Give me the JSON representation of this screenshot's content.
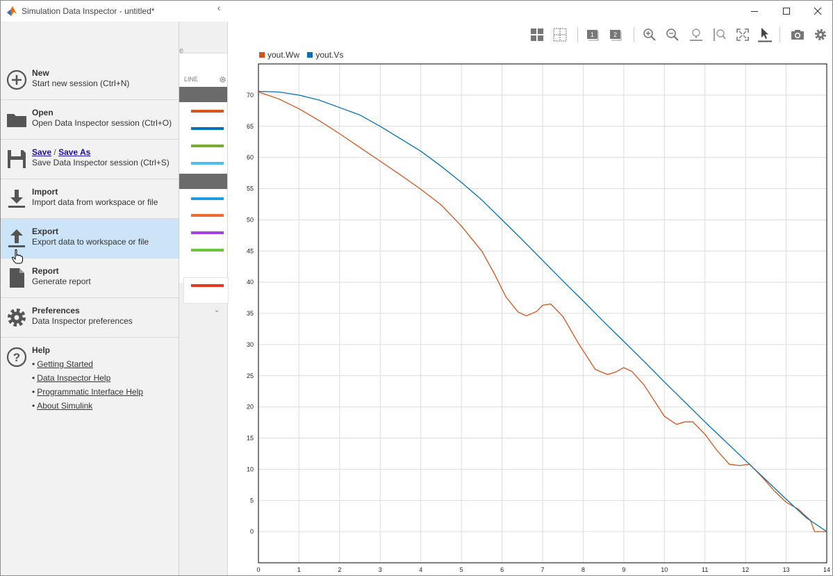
{
  "window": {
    "title": "Simulation Data Inspector - untitled*",
    "controls": [
      "minimize",
      "maximize",
      "close"
    ]
  },
  "menu": {
    "items": [
      {
        "key": "new",
        "title": "New",
        "subtitle": "Start new session (Ctrl+N)",
        "icon": "plus-circle-icon"
      },
      {
        "key": "open",
        "title": "Open",
        "subtitle": "Open Data Inspector session (Ctrl+O)",
        "icon": "folder-icon"
      },
      {
        "key": "save",
        "title": "Save",
        "title2": "Save As",
        "separator": "/",
        "subtitle": "Save Data Inspector session (Ctrl+S)",
        "icon": "floppy-disk-icon"
      },
      {
        "key": "import",
        "title": "Import",
        "subtitle": "Import data from workspace or file",
        "icon": "download-arrow-icon"
      },
      {
        "key": "export",
        "title": "Export",
        "subtitle": "Export data to workspace or file",
        "icon": "upload-arrow-icon",
        "active": true
      },
      {
        "key": "report",
        "title": "Report",
        "subtitle": "Generate report",
        "icon": "document-icon"
      },
      {
        "key": "preferences",
        "title": "Preferences",
        "subtitle": "Data Inspector preferences",
        "icon": "gear-icon"
      }
    ],
    "help": {
      "title": "Help",
      "links": [
        "Getting Started",
        "Data Inspector Help",
        "Programmatic Interface Help",
        "About Simulink"
      ]
    }
  },
  "signal_table_fragment": {
    "column_header": "LINE",
    "partial_text": "e",
    "line_colors": [
      "#d95319",
      "#0072bd",
      "#77ac30",
      "#4dbeee",
      "#1f9be6",
      "#ee6a2f",
      "#a93ee3",
      "#6dc53a",
      "#e8361e"
    ]
  },
  "toolbar": {
    "buttons": [
      "layout-grid-icon",
      "subplot-grid-icon",
      "plot-1-icon",
      "plot-2-icon",
      "zoom-in-icon",
      "zoom-out-icon",
      "zoom-horizontal-icon",
      "zoom-vertical-icon",
      "fit-to-view-icon",
      "cursor-icon",
      "snapshot-camera-icon",
      "settings-gear-icon"
    ]
  },
  "colors": {
    "accent_active": "#cce4f7",
    "series_ww": "#d95319",
    "series_vs": "#0072bd"
  },
  "chart_data": {
    "type": "line",
    "xlim": [
      0,
      14
    ],
    "ylim": [
      -5,
      75
    ],
    "xticks": [
      0,
      1,
      2,
      3,
      4,
      5,
      6,
      7,
      8,
      9,
      10,
      11,
      12,
      13,
      14
    ],
    "yticks": [
      0,
      5,
      10,
      15,
      20,
      25,
      30,
      35,
      40,
      45,
      50,
      55,
      60,
      65,
      70
    ],
    "grid": true,
    "legend": "top-left",
    "series": [
      {
        "name": "yout.Ww",
        "color": "#d95319",
        "x": [
          0,
          0.5,
          1,
          1.5,
          2,
          2.5,
          3,
          3.5,
          4,
          4.5,
          5,
          5.5,
          5.8,
          6.1,
          6.4,
          6.6,
          6.85,
          7.0,
          7.2,
          7.5,
          7.9,
          8.3,
          8.6,
          8.8,
          9.0,
          9.2,
          9.5,
          9.8,
          10.0,
          10.3,
          10.5,
          10.7,
          11.0,
          11.3,
          11.6,
          11.85,
          12.1,
          12.4,
          12.7,
          13.0,
          13.3,
          13.6,
          13.7,
          14.0
        ],
        "y": [
          70.5,
          69.4,
          67.8,
          65.9,
          63.8,
          61.6,
          59.4,
          57.2,
          54.9,
          52.4,
          49.0,
          45.0,
          41.5,
          37.6,
          35.2,
          34.6,
          35.3,
          36.3,
          36.5,
          34.5,
          30.0,
          26.0,
          25.2,
          25.6,
          26.3,
          25.7,
          23.5,
          20.5,
          18.5,
          17.2,
          17.6,
          17.6,
          15.6,
          13.0,
          10.8,
          10.6,
          10.8,
          8.8,
          6.6,
          4.7,
          3.6,
          1.8,
          0.0,
          0.0
        ]
      },
      {
        "name": "yout.Vs",
        "color": "#0072bd",
        "x": [
          0,
          0.5,
          1,
          1.5,
          2,
          2.5,
          3,
          3.5,
          4,
          4.5,
          5,
          5.5,
          6,
          6.5,
          7,
          7.5,
          8,
          8.5,
          9,
          9.5,
          10,
          10.5,
          11,
          11.5,
          12,
          12.5,
          13,
          13.5,
          14
        ],
        "y": [
          70.6,
          70.5,
          70.0,
          69.2,
          68.0,
          66.8,
          65.0,
          63.0,
          61.0,
          58.6,
          56.0,
          53.2,
          50.0,
          46.8,
          43.5,
          40.2,
          37.0,
          33.7,
          30.5,
          27.3,
          24.0,
          20.8,
          17.6,
          14.5,
          11.4,
          8.3,
          5.2,
          2.2,
          0.0
        ]
      }
    ]
  }
}
